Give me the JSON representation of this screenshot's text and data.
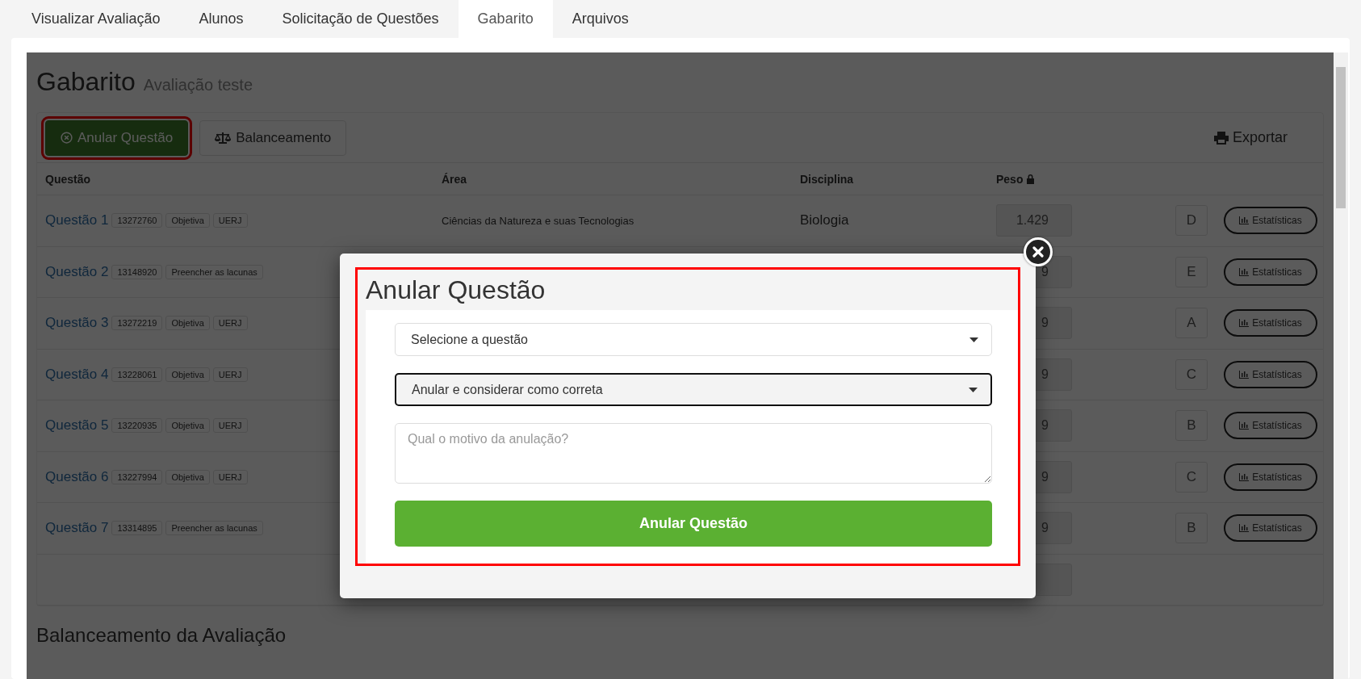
{
  "tabs": [
    {
      "label": "Visualizar Avaliação",
      "selected": false
    },
    {
      "label": "Alunos",
      "selected": false
    },
    {
      "label": "Solicitação de Questões",
      "selected": false
    },
    {
      "label": "Gabarito",
      "selected": true
    },
    {
      "label": "Arquivos",
      "selected": false
    }
  ],
  "page": {
    "title": "Gabarito",
    "subtitle": "Avaliação teste"
  },
  "toolbar": {
    "annul_button": "Anular Questão",
    "balance_button": "Balanceamento",
    "export_button": "Exportar"
  },
  "table": {
    "columns": [
      "Questão",
      "Área",
      "Disciplina",
      "Peso"
    ],
    "rows": [
      {
        "question": "Questão 1",
        "tags": [
          "13272760",
          "Objetiva",
          "UERJ"
        ],
        "area": "Ciências da Natureza e suas Tecnologias",
        "discipline": "Biologia",
        "weight": "1.429",
        "answer": "D",
        "stats": "Estatísticas"
      },
      {
        "question": "Questão 2",
        "tags": [
          "13148920",
          "Preencher as lacunas"
        ],
        "weight": "9",
        "answer": "E",
        "stats": "Estatísticas"
      },
      {
        "question": "Questão 3",
        "tags": [
          "13272219",
          "Objetiva",
          "UERJ"
        ],
        "weight": "9",
        "answer": "A",
        "stats": "Estatísticas"
      },
      {
        "question": "Questão 4",
        "tags": [
          "13228061",
          "Objetiva",
          "UERJ"
        ],
        "weight": "9",
        "answer": "C",
        "stats": "Estatísticas"
      },
      {
        "question": "Questão 5",
        "tags": [
          "13220935",
          "Objetiva",
          "UERJ"
        ],
        "weight": "9",
        "answer": "B",
        "stats": "Estatísticas"
      },
      {
        "question": "Questão 6",
        "tags": [
          "13227994",
          "Objetiva",
          "UERJ"
        ],
        "weight": "9",
        "answer": "C",
        "stats": "Estatísticas"
      },
      {
        "question": "Questão 7",
        "tags": [
          "13314895",
          "Preencher as lacunas"
        ],
        "weight": "9",
        "answer": "B",
        "stats": "Estatísticas"
      }
    ]
  },
  "section_title": "Balanceamento da Avaliação",
  "modal": {
    "title": "Anular Questão",
    "question_select": "Selecione a questão",
    "mode_select": "Anular e considerar como correta",
    "reason_placeholder": "Qual o motivo da anulação?",
    "submit": "Anular Questão"
  }
}
